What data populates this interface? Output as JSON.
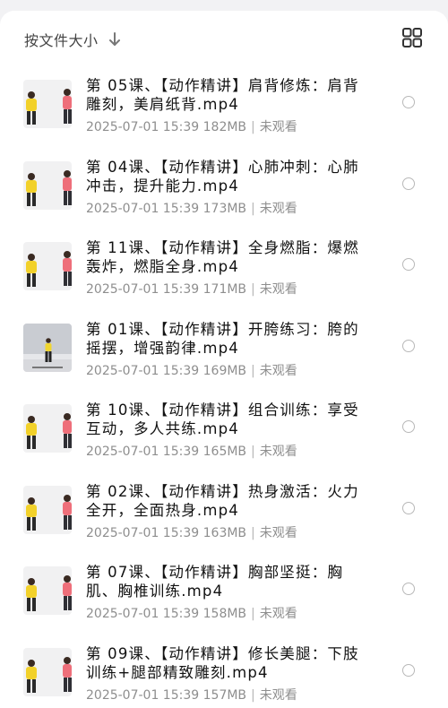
{
  "header": {
    "sort_label": "按文件大小",
    "sort_icon": "arrow-down-icon",
    "view_toggle_icon": "grid-view-icon"
  },
  "files": [
    {
      "title": "第 05课、【动作精讲】肩背修炼：肩背雕刻，美肩纸背.mp4",
      "date": "2025-07-01 15:39",
      "size": "182MB",
      "status": "未观看"
    },
    {
      "title": "第 04课、【动作精讲】心肺冲刺：心肺冲击，提升能力.mp4",
      "date": "2025-07-01 15:39",
      "size": "173MB",
      "status": "未观看"
    },
    {
      "title": "第 11课、【动作精讲】全身燃脂：爆燃轰炸，燃脂全身.mp4",
      "date": "2025-07-01 15:39",
      "size": "171MB",
      "status": "未观看"
    },
    {
      "title": "第 01课、【动作精讲】开胯练习：胯的摇摆，增强韵律.mp4",
      "date": "2025-07-01 15:39",
      "size": "169MB",
      "status": "未观看"
    },
    {
      "title": "第 10课、【动作精讲】组合训练：享受互动，多人共练.mp4",
      "date": "2025-07-01 15:39",
      "size": "165MB",
      "status": "未观看"
    },
    {
      "title": "第 02课、【动作精讲】热身激活：火力全开，全面热身.mp4",
      "date": "2025-07-01 15:39",
      "size": "163MB",
      "status": "未观看"
    },
    {
      "title": "第 07课、【动作精讲】胸部坚挺：胸肌、胸椎训练.mp4",
      "date": "2025-07-01 15:39",
      "size": "158MB",
      "status": "未观看"
    },
    {
      "title": "第 09课、【动作精讲】修长美腿：下肢训练+腿部精致雕刻.mp4",
      "date": "2025-07-01 15:39",
      "size": "157MB",
      "status": "未观看"
    }
  ]
}
